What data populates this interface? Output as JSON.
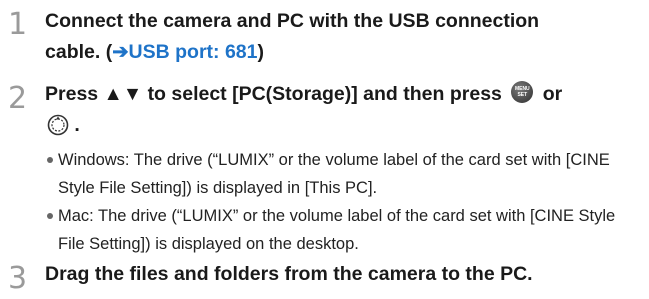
{
  "steps": [
    {
      "number": "1",
      "line1": "Connect the camera and PC with the USB connection",
      "line2_prefix": "cable. (",
      "arrow": "➔",
      "link": "USB port: 681",
      "line2_suffix": ")"
    },
    {
      "number": "2",
      "line1_prefix": "Press ▲▼ to select [PC(Storage)] and then press",
      "line1_suffix": "or",
      "line2_suffix": ".",
      "icons": [
        "menu-set-button-icon",
        "control-dial-icon"
      ],
      "bullets": [
        "Windows: The drive (“LUMIX” or the volume label of the card set with [CINE Style File Setting]) is displayed in [This PC].",
        "Mac: The drive (“LUMIX” or the volume label of the card set with [CINE Style File Setting]) is displayed on the desktop."
      ]
    },
    {
      "number": "3",
      "line1": "Drag the files and folders from the camera to the PC."
    }
  ],
  "colors": {
    "link": "#1e73c8",
    "step_number": "#9a9a9a"
  }
}
